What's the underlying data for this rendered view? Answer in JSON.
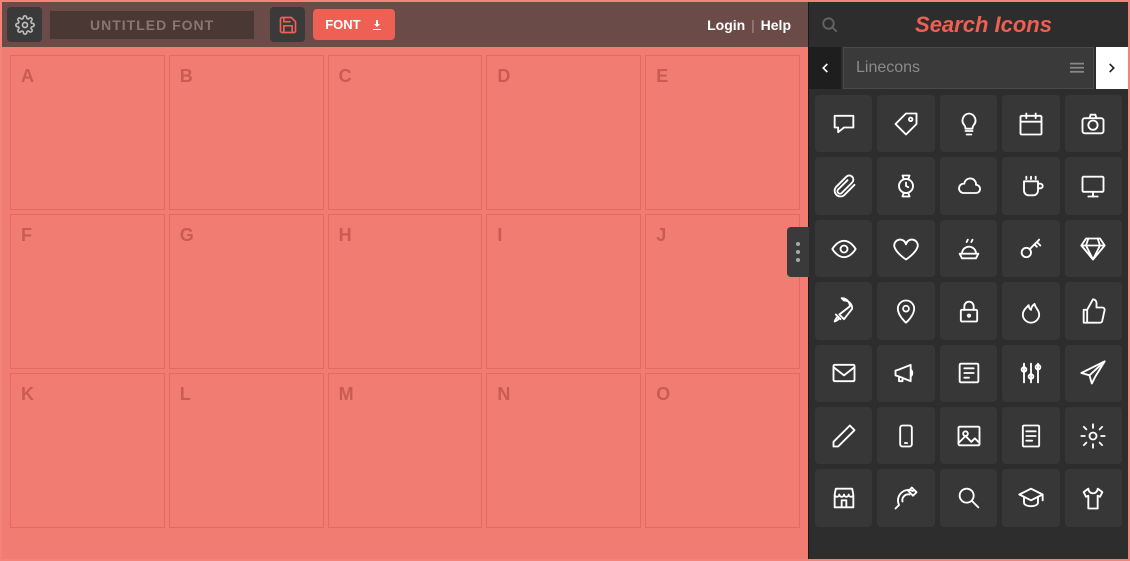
{
  "toolbar": {
    "title": "UNTITLED FONT",
    "font_btn_label": "FONT",
    "login_label": "Login",
    "help_label": "Help"
  },
  "grid_rows": [
    [
      "A",
      "B",
      "C",
      "D",
      "E"
    ],
    [
      "F",
      "G",
      "H",
      "I",
      "J"
    ],
    [
      "K",
      "L",
      "M",
      "N",
      "O"
    ]
  ],
  "sidebar": {
    "title": "Search Icons",
    "pack_name": "Linecons",
    "icons": [
      "speech-bubble",
      "tag",
      "lightbulb",
      "calendar",
      "camera",
      "paperclip",
      "watch",
      "cloud",
      "cup",
      "monitor",
      "eye",
      "heart",
      "food",
      "key",
      "diamond",
      "rocket",
      "location-pin",
      "lock",
      "fire",
      "thumbs-up",
      "envelope",
      "megaphone",
      "newspaper",
      "settings-sliders",
      "paper-plane",
      "pencil",
      "phone",
      "picture",
      "document",
      "gear",
      "shop",
      "satellite",
      "search",
      "graduation-cap",
      "t-shirt"
    ]
  }
}
